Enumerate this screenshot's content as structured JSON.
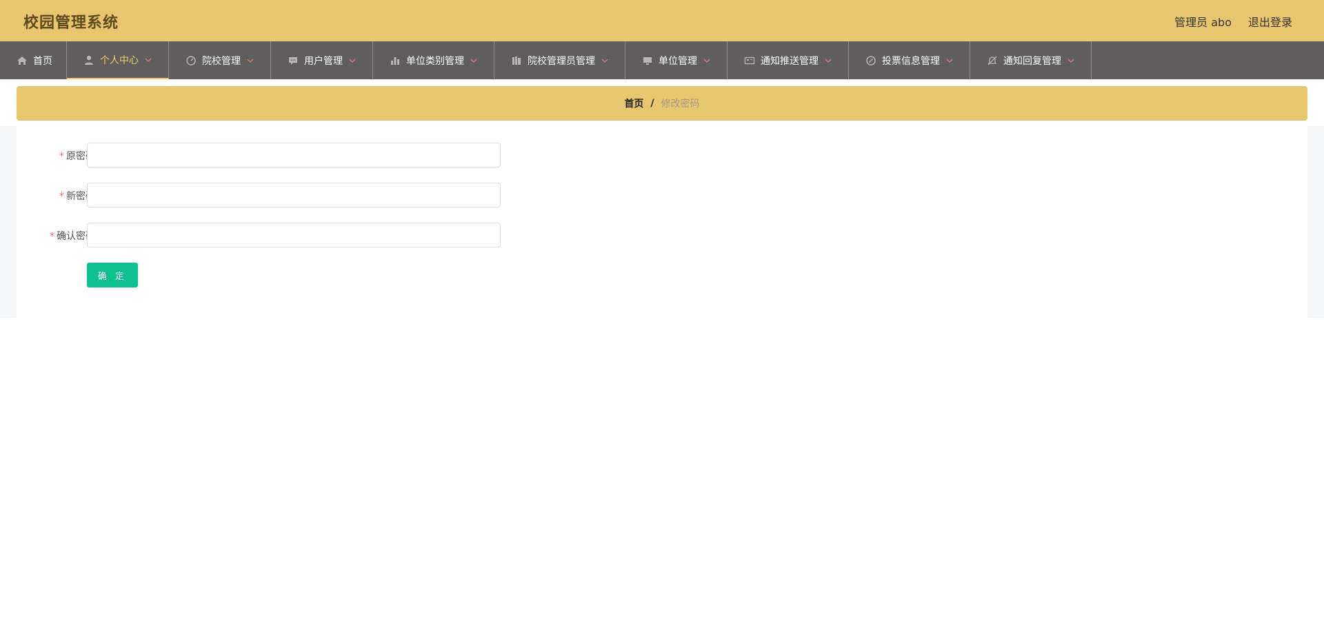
{
  "app": {
    "title": "校园管理系统"
  },
  "header": {
    "user_role": "管理员",
    "username": "abo",
    "logout_label": "退出登录"
  },
  "nav": {
    "items": [
      {
        "label": "首页",
        "icon": "home-icon",
        "active": false,
        "has_dropdown": false
      },
      {
        "label": "个人中心",
        "icon": "user-icon",
        "active": true,
        "has_dropdown": true
      },
      {
        "label": "院校管理",
        "icon": "gauge-icon",
        "active": false,
        "has_dropdown": true
      },
      {
        "label": "用户管理",
        "icon": "chat-icon",
        "active": false,
        "has_dropdown": true
      },
      {
        "label": "单位类别管理",
        "icon": "bar-chart-icon",
        "active": false,
        "has_dropdown": true
      },
      {
        "label": "院校管理员管理",
        "icon": "books-icon",
        "active": false,
        "has_dropdown": true
      },
      {
        "label": "单位管理",
        "icon": "monitor-icon",
        "active": false,
        "has_dropdown": true
      },
      {
        "label": "通知推送管理",
        "icon": "card-icon",
        "active": false,
        "has_dropdown": true
      },
      {
        "label": "投票信息管理",
        "icon": "compass-icon",
        "active": false,
        "has_dropdown": true
      },
      {
        "label": "通知回复管理",
        "icon": "bell-off-icon",
        "active": false,
        "has_dropdown": true
      }
    ]
  },
  "breadcrumb": {
    "home": "首页",
    "separator": "/",
    "current": "修改密码"
  },
  "form": {
    "old_password": {
      "label": "原密码",
      "required_mark": "*",
      "value": ""
    },
    "new_password": {
      "label": "新密码",
      "required_mark": "*",
      "value": ""
    },
    "confirm_password": {
      "label": "确认密码",
      "required_mark": "*",
      "value": ""
    },
    "submit_label": "确 定"
  },
  "colors": {
    "header_bg": "#e8c56f",
    "nav_bg": "#5f5d5d",
    "nav_active": "#f5c969",
    "chevron": "#e07a7a",
    "required": "#f56c6c",
    "submit": "#0ec08f"
  }
}
